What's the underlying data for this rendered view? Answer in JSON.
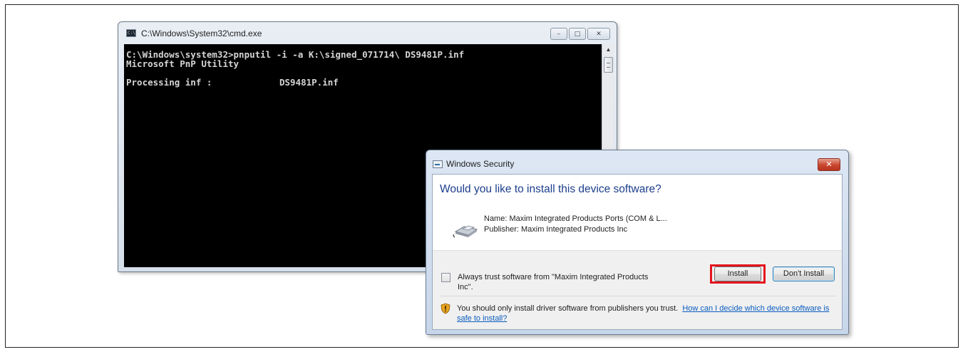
{
  "cmd": {
    "title": "C:\\Windows\\System32\\cmd.exe",
    "icon_label": "C:\\",
    "lines": [
      "C:\\Windows\\system32>pnputil -i -a K:\\signed_071714\\ DS9481P.inf",
      "Microsoft PnP Utility"
    ],
    "processing_label": "Processing inf :",
    "processing_file": "DS9481P.inf",
    "controls": {
      "minimize": "–",
      "maximize": "□",
      "close": "✕"
    }
  },
  "security_dialog": {
    "title": "Windows Security",
    "close_label": "✕",
    "question": "Would you like to install this device software?",
    "device_name": "Name: Maxim Integrated Products Ports (COM & L...",
    "device_publisher": "Publisher: Maxim Integrated Products Inc",
    "trust_label": "Always trust software from \"Maxim Integrated Products Inc\".",
    "install_label": "Install",
    "dont_install_label": "Don't Install",
    "warning_text": "You should only install driver software from publishers you trust.",
    "warning_link": "How can I decide which device software is safe to install?"
  },
  "icons": [
    "cmd-app-icon",
    "minimize-icon",
    "maximize-icon",
    "close-icon",
    "scroll-up-icon",
    "security-dialog-icon",
    "device-port-icon",
    "shield-icon"
  ],
  "colors": {
    "install_highlight": "#e4141d",
    "question_text": "#1c3e8c",
    "link": "#0b5dbf",
    "close_button": "#c9452c"
  }
}
